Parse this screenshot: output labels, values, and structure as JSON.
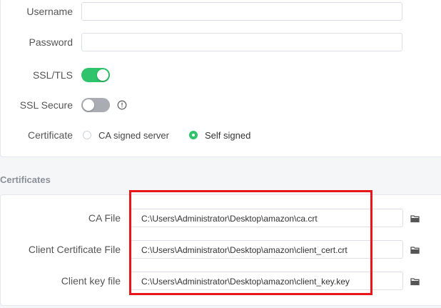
{
  "connection": {
    "username": {
      "label": "Username",
      "value": ""
    },
    "password": {
      "label": "Password",
      "value": ""
    },
    "ssl_tls": {
      "label": "SSL/TLS",
      "enabled": true
    },
    "ssl_secure": {
      "label": "SSL Secure",
      "enabled": false
    },
    "certificate": {
      "label": "Certificate",
      "options": [
        "CA signed server",
        "Self signed"
      ],
      "selected": "Self signed"
    }
  },
  "certificates": {
    "section_title": "Certificates",
    "ca_file": {
      "label": "CA File",
      "value": "C:\\Users\\Administrator\\Desktop\\amazon\\ca.crt"
    },
    "client_cert": {
      "label": "Client Certificate File",
      "value": "C:\\Users\\Administrator\\Desktop\\amazon\\client_cert.crt"
    },
    "client_key": {
      "label": "Client key file",
      "value": "C:\\Users\\Administrator\\Desktop\\amazon\\client_key.key"
    }
  },
  "colors": {
    "accent": "#2fc36b",
    "toggle_off": "#a9acb2",
    "highlight": "#e8151b"
  },
  "icons": [
    "info-icon",
    "folder-icon"
  ]
}
